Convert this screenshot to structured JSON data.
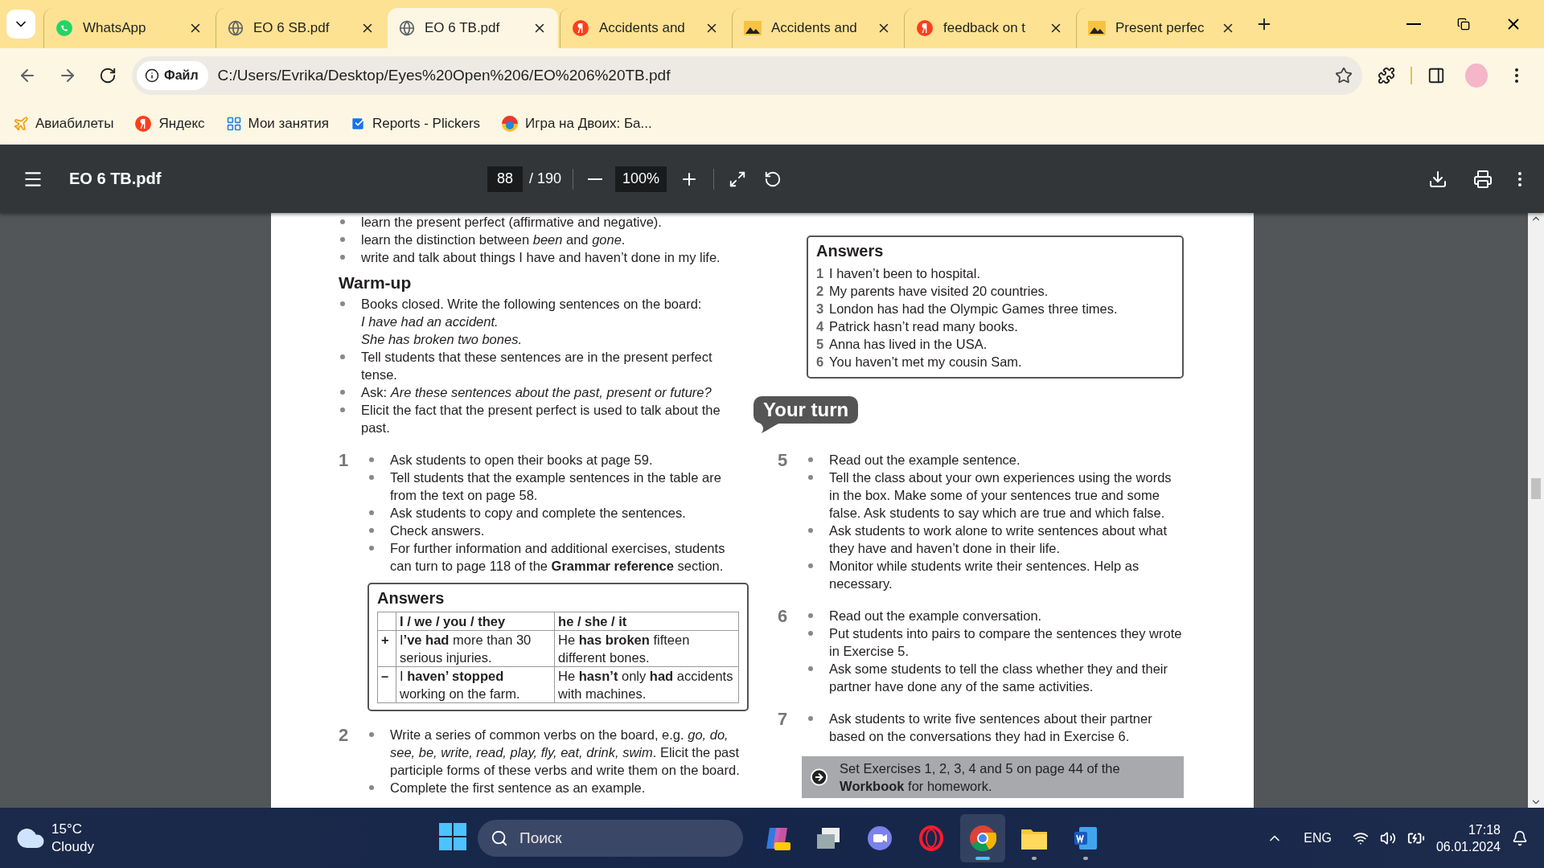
{
  "browser": {
    "tabs": [
      {
        "kind": "whatsapp",
        "title": "WhatsApp",
        "selected": false
      },
      {
        "kind": "globe",
        "title": "EO 6 SB.pdf",
        "selected": false
      },
      {
        "kind": "globe",
        "title": "EO 6 TB.pdf",
        "selected": true
      },
      {
        "kind": "yandex",
        "title": "Accidents and",
        "selected": false
      },
      {
        "kind": "image",
        "title": "Accidents and",
        "selected": false
      },
      {
        "kind": "yandex",
        "title": "feedback on t",
        "selected": false
      },
      {
        "kind": "image",
        "title": "Present perfec",
        "selected": false
      }
    ],
    "address": {
      "chip": "Файл",
      "url": "C:/Users/Evrika/Desktop/Eyes%20Open%206/EO%206%20TB.pdf"
    },
    "bookmarks": [
      {
        "kind": "flights",
        "label": "Авиабилеты"
      },
      {
        "kind": "yandex",
        "label": "Яндекс"
      },
      {
        "kind": "grid",
        "label": "Мои занятия"
      },
      {
        "kind": "check",
        "label": "Reports - Plickers"
      },
      {
        "kind": "ball",
        "label": "Игра на Двоих: Ба..."
      }
    ]
  },
  "pdf_toolbar": {
    "title": "EO 6 TB.pdf",
    "page": "88",
    "page_count": "/ 190",
    "zoom": "100%"
  },
  "page": {
    "left": [
      {
        "kind": "bullets",
        "items": [
          {
            "text": "learn the present perfect (affirmative and negative)."
          },
          {
            "text": "learn the distinction between *been* and *gone*."
          },
          {
            "text": "write and talk about things I have and haven’t done in my life."
          }
        ]
      },
      {
        "kind": "heading",
        "text": "Warm-up"
      },
      {
        "kind": "bullets",
        "items": [
          {
            "text": "Books closed. Write the following sentences on the board:",
            "lines": [
              "I have had an accident.",
              "She has broken two bones."
            ]
          },
          {
            "text": "Tell students that these sentences are in the present perfect tense."
          },
          {
            "text": "Ask: *Are these sentences about the past, present or future?*"
          },
          {
            "text": "Elicit the fact that the present perfect is used to talk about the past."
          }
        ]
      },
      {
        "kind": "exercise",
        "number": "1",
        "bullets": [
          "Ask students to open their books at page 59.",
          "Tell students that the example sentences in the table are from the text on page 58.",
          "Ask students to copy and complete the sentences.",
          "Check answers.",
          "For further information and additional exercises, students can turn to page 118 of the **Grammar reference** section."
        ]
      },
      {
        "kind": "answer_table",
        "heading": "Answers",
        "columns": [
          "I / we / you / they",
          "he / she / it"
        ],
        "rows": [
          {
            "sign": "+",
            "cells": [
              "I**’ve had** more than 30 serious injuries.",
              "He **has broken** fifteen different bones."
            ]
          },
          {
            "sign": "–",
            "cells": [
              "I **haven’ stopped** working on the farm.",
              "He **hasn’t** only **had** accidents with machines."
            ]
          }
        ]
      },
      {
        "kind": "exercise",
        "number": "2",
        "bullets": [
          "Write a series of common verbs on the board, e.g. *go, do, see, be, write, read, play, fly, eat, drink, swim*. Elicit the past participle forms of these verbs and write them on the board.",
          "Complete the first sentence as an example."
        ]
      }
    ],
    "right": [
      {
        "kind": "answer_list",
        "heading": "Answers",
        "items": [
          {
            "number": "1",
            "text": "I haven’t been to hospital."
          },
          {
            "number": "2",
            "text": "My parents have visited 20 countries."
          },
          {
            "number": "3",
            "text": "London has had the Olympic Games three times."
          },
          {
            "number": "4",
            "text": "Patrick hasn’t read many books."
          },
          {
            "number": "5",
            "text": "Anna has lived in the USA."
          },
          {
            "number": "6",
            "text": "You haven’t met my cousin Sam."
          }
        ]
      },
      {
        "kind": "your_turn",
        "text": "Your turn"
      },
      {
        "kind": "exercise",
        "number": "5",
        "bullets": [
          "Read out the example sentence.",
          "Tell the class about your own experiences using the words in the box. Make some of your sentences true and some false. Ask students to say which are true and which false.",
          "Ask students to work alone to write sentences about what they have and haven’t done in their life.",
          "Monitor while students write their sentences. Help as necessary."
        ]
      },
      {
        "kind": "exercise",
        "number": "6",
        "bullets": [
          "Read out the example conversation.",
          "Put students into pairs to compare the sentences they wrote in Exercise 5.",
          "Ask some students to tell the class whether they and their partner have done any of the same activities."
        ]
      },
      {
        "kind": "exercise",
        "number": "7",
        "bullets": [
          "Ask students to write five sentences about their partner based on the conversations they had in Exercise 6."
        ]
      },
      {
        "kind": "homework",
        "text": "Set Exercises 1, 2, 3, 4 and 5 on page 44 of the **Workbook** for homework."
      }
    ]
  },
  "taskbar": {
    "weather": {
      "temperature": "15°C",
      "condition": "Cloudy"
    },
    "search": {
      "placeholder": "Поиск"
    },
    "apps": [
      {
        "kind": "copilot",
        "selected": false,
        "running": false
      },
      {
        "kind": "taskview",
        "selected": false,
        "running": false
      },
      {
        "kind": "meet",
        "selected": false,
        "running": false
      },
      {
        "kind": "opera",
        "selected": false,
        "running": false
      },
      {
        "kind": "chrome",
        "selected": true,
        "running": true
      },
      {
        "kind": "folder",
        "selected": false,
        "running": true
      },
      {
        "kind": "word",
        "selected": false,
        "running": true
      }
    ],
    "tray": {
      "language": "ENG",
      "time": "17:18",
      "date": "06.01.2024"
    }
  }
}
